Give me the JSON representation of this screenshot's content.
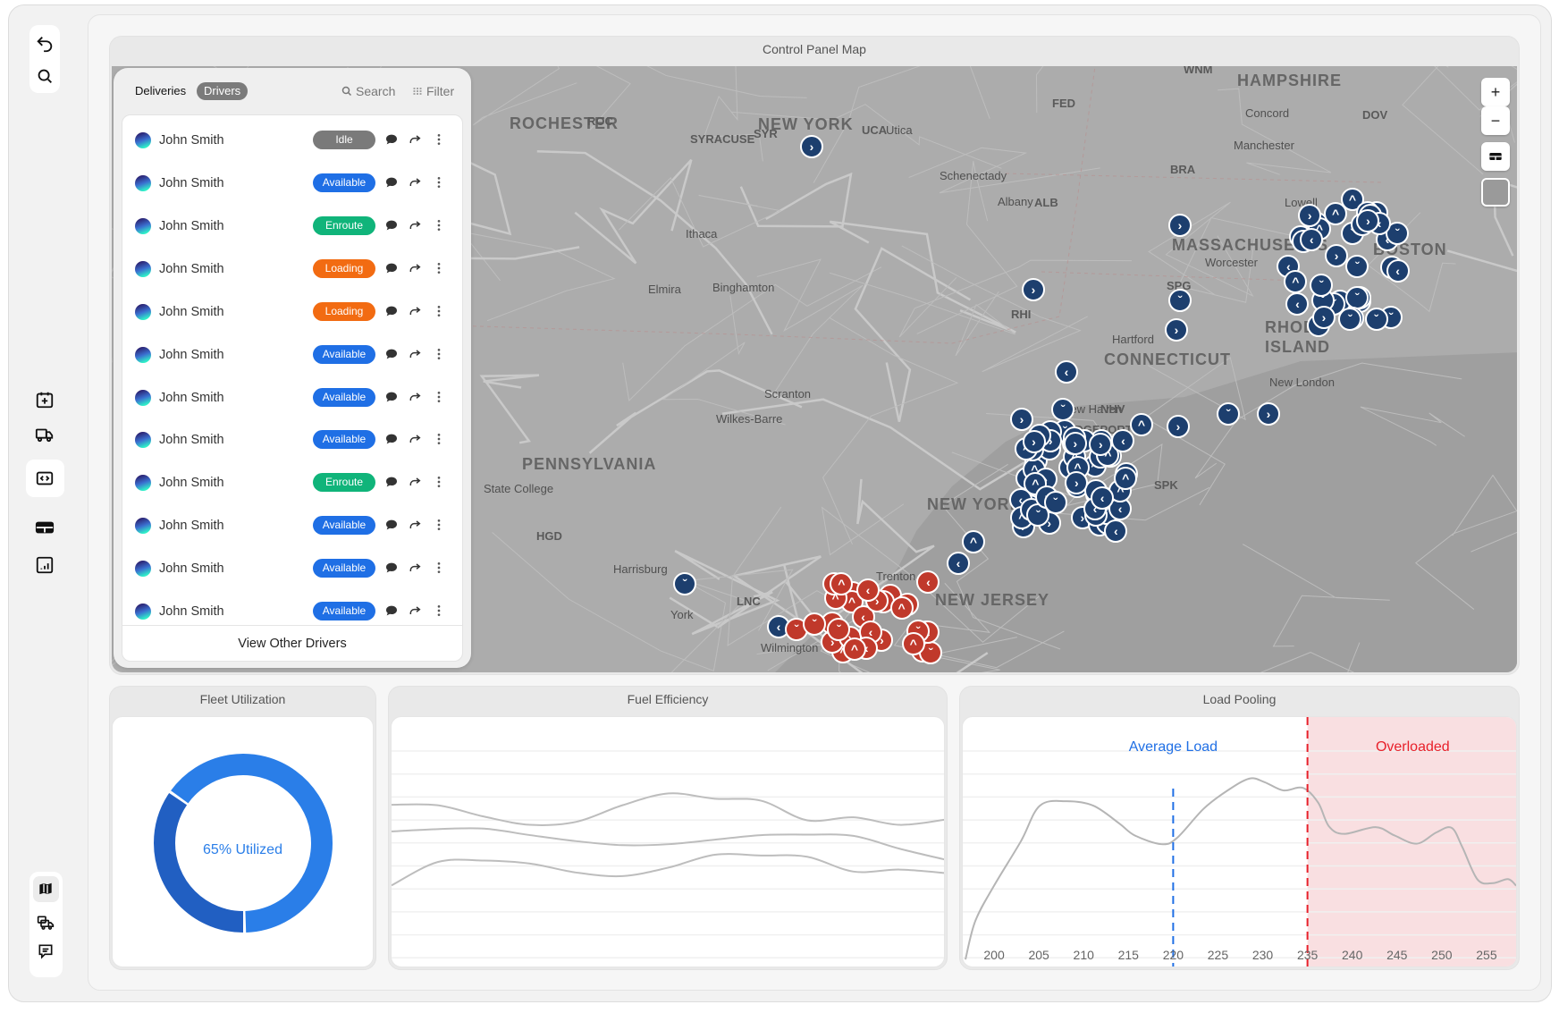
{
  "sidebar": {
    "top": [
      {
        "icon": "undo-icon"
      },
      {
        "icon": "search-icon"
      }
    ],
    "middle": [
      {
        "icon": "calendar-add-icon"
      },
      {
        "icon": "truck-icon"
      },
      {
        "icon": "code-icon",
        "active": true
      },
      {
        "icon": "table-icon"
      },
      {
        "icon": "bar-chart-icon"
      }
    ],
    "bottom": [
      {
        "icon": "map-icon",
        "active": true
      },
      {
        "icon": "fleet-icon"
      },
      {
        "icon": "chat-icon"
      }
    ]
  },
  "map_card": {
    "title": "Control Panel Map",
    "controls": {
      "zoom_in": "+",
      "zoom_out": "−"
    },
    "labels": [
      "ROCHESTER",
      "ROC",
      "SYRACUSE",
      "SYR",
      "NEW YORK",
      "UCA",
      "Utica",
      "FED",
      "WNM",
      "HAMPSHIRE",
      "Concord",
      "DOV",
      "Manchester",
      "Schenectady",
      "Albany",
      "ALB",
      "BRA",
      "Lowell",
      "MASSACHUSETTS",
      "BOSTON",
      "Worcester",
      "Ithaca",
      "Elmira",
      "Binghamton",
      "SPG",
      "RHI",
      "Hartford",
      "CONNECTICUT",
      "RHODE",
      "ISLAND",
      "New London",
      "New Haven",
      "NHV",
      "BRIDGEPORT",
      "Scranton",
      "Wilkes-Barre",
      "PENNSYLVANIA",
      "State College",
      "NEW YORK",
      "SPK",
      "HGD",
      "Harrisburg",
      "LNC",
      "York",
      "Wilmington",
      "Trenton",
      "NEW JERSEY"
    ],
    "marker_colors": {
      "driver": "#1d3f6e",
      "delivery": "#c0392b"
    }
  },
  "drivers_panel": {
    "tabs": [
      {
        "label": "Deliveries",
        "active": false
      },
      {
        "label": "Drivers",
        "active": true
      }
    ],
    "search_label": "Search",
    "filter_label": "Filter",
    "rows": [
      {
        "name": "John Smith",
        "status": "Idle"
      },
      {
        "name": "John Smith",
        "status": "Available"
      },
      {
        "name": "John Smith",
        "status": "Enroute"
      },
      {
        "name": "John Smith",
        "status": "Loading"
      },
      {
        "name": "John Smith",
        "status": "Loading"
      },
      {
        "name": "John Smith",
        "status": "Available"
      },
      {
        "name": "John Smith",
        "status": "Available"
      },
      {
        "name": "John Smith",
        "status": "Available"
      },
      {
        "name": "John Smith",
        "status": "Enroute"
      },
      {
        "name": "John Smith",
        "status": "Available"
      },
      {
        "name": "John Smith",
        "status": "Available"
      },
      {
        "name": "John Smith",
        "status": "Available"
      }
    ],
    "status_colors": {
      "Idle": "#7a7a7a",
      "Available": "#1f6fe5",
      "Enroute": "#10b47a",
      "Loading": "#f26b12"
    },
    "view_other": "View Other Drivers"
  },
  "chart_data": [
    {
      "type": "pie",
      "title": "Fleet Utilization",
      "center_label": "65% Utilized",
      "values": [
        65,
        35
      ],
      "colors": [
        "#2a7ee8",
        "#215fc2"
      ]
    },
    {
      "type": "line",
      "title": "Fuel Efficiency",
      "x": [
        1,
        2,
        3,
        4,
        5,
        6,
        7,
        8,
        9,
        10,
        11,
        12,
        13
      ],
      "ylim": [
        0,
        100
      ],
      "grid": true,
      "series": [
        {
          "values": [
            65.1,
            64.9,
            60.4,
            57.1,
            58.3,
            64.9,
            69.6,
            67.5,
            66.7,
            58.9,
            60.1,
            57.1,
            59.2
          ]
        },
        {
          "values": [
            54.5,
            55.4,
            55.6,
            53,
            50.6,
            49,
            49.4,
            51.2,
            53,
            53.2,
            52.7,
            47.6,
            43.2
          ]
        },
        {
          "values": [
            33,
            42.3,
            42.9,
            41.7,
            38.1,
            36.7,
            40.1,
            45.2,
            44.9,
            44.4,
            38.5,
            39.3,
            37.9
          ]
        }
      ]
    },
    {
      "type": "line",
      "title": "Load Pooling",
      "xlim": [
        196.5,
        258.5
      ],
      "ylim": [
        0,
        100
      ],
      "grid": true,
      "xticks": [
        200,
        205,
        210,
        215,
        220,
        225,
        230,
        235,
        240,
        245,
        250,
        255
      ],
      "x": [
        196.8,
        197.9,
        200,
        203,
        205.1,
        208.1,
        211.1,
        214,
        215.7,
        218.7,
        220.4,
        223.4,
        226,
        228.5,
        230.2,
        232.3,
        234.5,
        236.2,
        237.4,
        239.1,
        242.6,
        244.7,
        247.2,
        249.4,
        251.1,
        252.3,
        254,
        255.7,
        257.4,
        258.3
      ],
      "values": [
        3.5,
        18.8,
        32.9,
        50.6,
        64.7,
        66.5,
        64.7,
        57.6,
        52.9,
        49.4,
        51.8,
        63.5,
        70.6,
        75.5,
        74.1,
        70.8,
        71.8,
        65.9,
        56.5,
        53.5,
        56.2,
        52.9,
        49.6,
        54.1,
        55.9,
        48.2,
        35.3,
        33.9,
        35.5,
        32.9
      ],
      "annotations": [
        {
          "label": "Average Load",
          "x": 220,
          "color": "#1f6fe5"
        },
        {
          "label": "Overloaded",
          "x": 235,
          "color": "#e8202a",
          "shaded_region": "right"
        }
      ]
    }
  ]
}
